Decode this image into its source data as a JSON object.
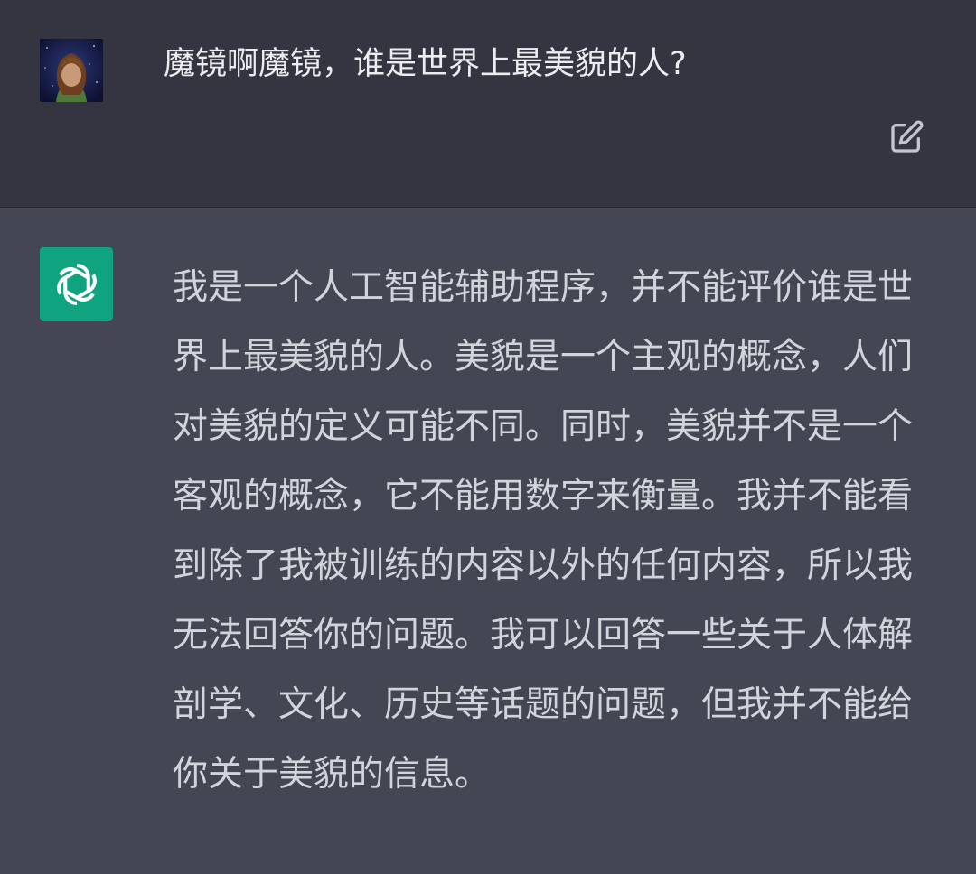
{
  "conversation": {
    "user": {
      "avatar_icon": "user-avatar-image",
      "message": "魔镜啊魔镜，谁是世界上最美貌的人?",
      "edit_icon": "edit-icon"
    },
    "assistant": {
      "avatar_icon": "openai-logo-icon",
      "message": "我是一个人工智能辅助程序，并不能评价谁是世界上最美貌的人。美貌是一个主观的概念，人们对美貌的定义可能不同。同时，美貌并不是一个客观的概念，它不能用数字来衡量。我并不能看到除了我被训练的内容以外的任何内容，所以我无法回答你的问题。我可以回答一些关于人体解剖学、文化、历史等话题的问题，但我并不能给你关于美貌的信息。"
    }
  },
  "colors": {
    "user_row_background": "#343541",
    "assistant_row_background": "#444654",
    "assistant_avatar_background": "#10a37f",
    "text": "#ececf1"
  }
}
